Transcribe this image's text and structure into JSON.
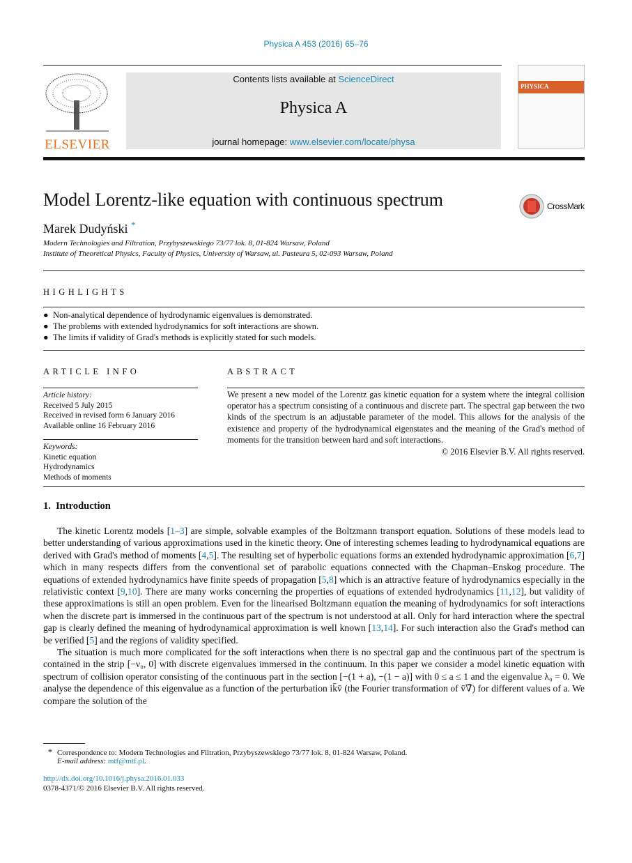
{
  "journal_ref": "Physica A 453 (2016) 65–76",
  "header": {
    "contents_prefix": "Contents lists available at ",
    "contents_link": "ScienceDirect",
    "journal_name": "Physica A",
    "homepage_prefix": "journal homepage: ",
    "homepage_link": "www.elsevier.com/locate/physa",
    "publisher_logo": "ELSEVIER",
    "cover_title": "PHYSICA"
  },
  "article": {
    "title": "Model Lorentz-like equation with continuous spectrum",
    "author": "Marek Dudyński",
    "author_mark": "*",
    "crossmark": "CrossMark",
    "affiliations": [
      "Modern Technologies and Filtration, Przybyszewskiego 73/77 lok. 8, 01-824 Warsaw, Poland",
      "Institute of Theoretical Physics, Faculty of Physics, University of Warsaw, ul. Pasteura 5, 02-093 Warsaw, Poland"
    ]
  },
  "highlights": {
    "heading": "HIGHLIGHTS",
    "items": [
      "Non-analytical dependence of hydrodynamic eigenvalues is demonstrated.",
      "The problems with extended hydrodynamics for soft interactions are shown.",
      "The limits if validity of Grad's methods is explicitly stated for such models."
    ]
  },
  "article_info": {
    "heading": "ARTICLE INFO",
    "history_label": "Article history:",
    "history": [
      "Received 5 July 2015",
      "Received in revised form 6 January 2016",
      "Available online 16 February 2016"
    ],
    "keywords_label": "Keywords:",
    "keywords": [
      "Kinetic equation",
      "Hydrodynamics",
      "Methods of moments"
    ]
  },
  "abstract": {
    "heading": "ABSTRACT",
    "text": "We present a new model of the Lorentz gas kinetic equation for a system where the integral collision operator has a spectrum consisting of a continuous and discrete part. The spectral gap between the two kinds of the spectrum is an adjustable parameter of the model. This allows for the analysis of the existence and property of the hydrodynamical eigenstates and the meaning of the Grad's method of moments for the transition between hard and soft interactions.",
    "copyright": "© 2016 Elsevier B.V. All rights reserved."
  },
  "intro": {
    "heading": "1.  Introduction",
    "paragraphs": [
      [
        [
          "The kinetic Lorentz models [",
          0
        ],
        [
          "1–3",
          1
        ],
        [
          "] are simple, solvable examples of the Boltzmann transport equation. Solutions of these models lead to better understanding of various approximations used in the kinetic theory. One of interesting schemes leading to hydrodynamical equations are derived with Grad's method of moments [",
          0
        ],
        [
          "4",
          1
        ],
        [
          ",",
          0
        ],
        [
          "5",
          1
        ],
        [
          "]. The resulting set of hyperbolic equations forms an extended hydrodynamic approximation [",
          0
        ],
        [
          "6",
          1
        ],
        [
          ",",
          0
        ],
        [
          "7",
          1
        ],
        [
          "] which in many respects differs from the conventional set of parabolic equations connected with the Chapman–Enskog procedure. The equations of extended hydrodynamics have finite speeds of propagation [",
          0
        ],
        [
          "5",
          1
        ],
        [
          ",",
          0
        ],
        [
          "8",
          1
        ],
        [
          "] which is an attractive feature of hydrodynamics especially in the relativistic context [",
          0
        ],
        [
          "9",
          1
        ],
        [
          ",",
          0
        ],
        [
          "10",
          1
        ],
        [
          "]. There are many works concerning the properties of equations of extended hydrodynamics [",
          0
        ],
        [
          "11",
          1
        ],
        [
          ",",
          0
        ],
        [
          "12",
          1
        ],
        [
          "], but validity of these approximations is still an open problem. Even for the linearised Boltzmann equation the meaning of hydrodynamics for soft interactions when the discrete part is immersed in the continuous part of the spectrum is not understood at all. Only for hard interaction where the spectral gap is clearly defined the meaning of hydrodynamical approximation is well known [",
          0
        ],
        [
          "13",
          1
        ],
        [
          ",",
          0
        ],
        [
          "14",
          1
        ],
        [
          "]. For such interaction also the Grad's method can be verified [",
          0
        ],
        [
          "5",
          1
        ],
        [
          "] and the regions of validity specified.",
          0
        ]
      ],
      [
        [
          "The situation is much more complicated for the soft interactions when there is no spectral gap and the continuous part of the spectrum is contained in the strip [−ν₀, 0] with discrete eigenvalues immersed in the continuum. In this paper we consider a model kinetic equation with spectrum of collision operator consisting of the continuous part in the section [−(1 + a), −(1 − a)] with 0 ≤ a ≤ 1 and the eigenvalue λ₀ = 0. We analyse the dependence of this eigenvalue as a function of the perturbation ik̄v̄ (the Fourier transformation of v̄∇̄) for different values of a. We compare the solution of the",
          0
        ]
      ]
    ]
  },
  "footnote": {
    "mark": "*",
    "text": "Correspondence to: Modern Technologies and Filtration, Przybyszewskiego 73/77 lok. 8, 01-824 Warsaw, Poland.",
    "email_label": "E-mail address: ",
    "email": "mtf@mtf.pl",
    "email_end": ".",
    "doi": "http://dx.doi.org/10.1016/j.physa.2016.01.033",
    "issn": "0378-4371/© 2016 Elsevier B.V. All rights reserved."
  },
  "colors": {
    "link": "#1a88b8",
    "elsevier_orange": "#e9711c"
  }
}
